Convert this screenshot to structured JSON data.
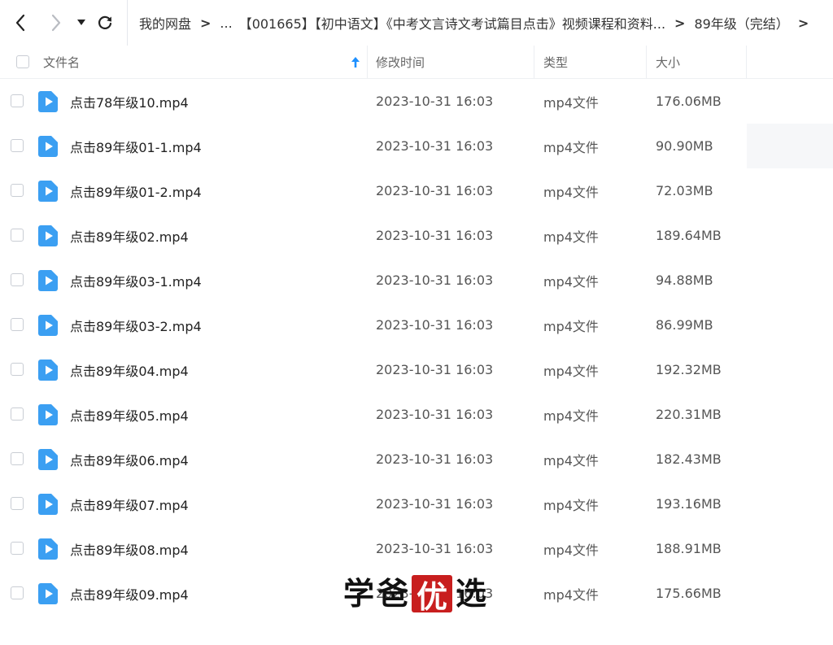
{
  "nav": {
    "back_icon": "chevron-left-icon",
    "forward_icon": "chevron-right-icon",
    "dropdown_icon": "caret-down-icon",
    "refresh_icon": "refresh-icon",
    "separator": ">"
  },
  "breadcrumb": {
    "root": "我的网盘",
    "ellipsis": "...",
    "folder": "【001665】【初中语文】《中考文言诗文考试篇目点击》视频课程和资料...",
    "current": "89年级（完结）"
  },
  "columns": {
    "name": "文件名",
    "modified": "修改时间",
    "type": "类型",
    "size": "大小",
    "sort_icon": "arrow-up-icon"
  },
  "colors": {
    "accent": "#1e90ff",
    "file_icon": "#3b9ff2",
    "watermark_stamp": "#c81e1e"
  },
  "files": [
    {
      "name": "点击78年级10.mp4",
      "modified": "2023-10-31 16:03",
      "type": "mp4文件",
      "size": "176.06MB"
    },
    {
      "name": "点击89年级01-1.mp4",
      "modified": "2023-10-31 16:03",
      "type": "mp4文件",
      "size": "90.90MB"
    },
    {
      "name": "点击89年级01-2.mp4",
      "modified": "2023-10-31 16:03",
      "type": "mp4文件",
      "size": "72.03MB"
    },
    {
      "name": "点击89年级02.mp4",
      "modified": "2023-10-31 16:03",
      "type": "mp4文件",
      "size": "189.64MB"
    },
    {
      "name": "点击89年级03-1.mp4",
      "modified": "2023-10-31 16:03",
      "type": "mp4文件",
      "size": "94.88MB"
    },
    {
      "name": "点击89年级03-2.mp4",
      "modified": "2023-10-31 16:03",
      "type": "mp4文件",
      "size": "86.99MB"
    },
    {
      "name": "点击89年级04.mp4",
      "modified": "2023-10-31 16:03",
      "type": "mp4文件",
      "size": "192.32MB"
    },
    {
      "name": "点击89年级05.mp4",
      "modified": "2023-10-31 16:03",
      "type": "mp4文件",
      "size": "220.31MB"
    },
    {
      "name": "点击89年级06.mp4",
      "modified": "2023-10-31 16:03",
      "type": "mp4文件",
      "size": "182.43MB"
    },
    {
      "name": "点击89年级07.mp4",
      "modified": "2023-10-31 16:03",
      "type": "mp4文件",
      "size": "193.16MB"
    },
    {
      "name": "点击89年级08.mp4",
      "modified": "2023-10-31 16:03",
      "type": "mp4文件",
      "size": "188.91MB"
    },
    {
      "name": "点击89年级09.mp4",
      "modified": "2023-10-31 16:03",
      "type": "mp4文件",
      "size": "175.66MB"
    }
  ],
  "watermark": {
    "char1": "学",
    "char2": "爸",
    "char3": "优",
    "char4": "选"
  }
}
